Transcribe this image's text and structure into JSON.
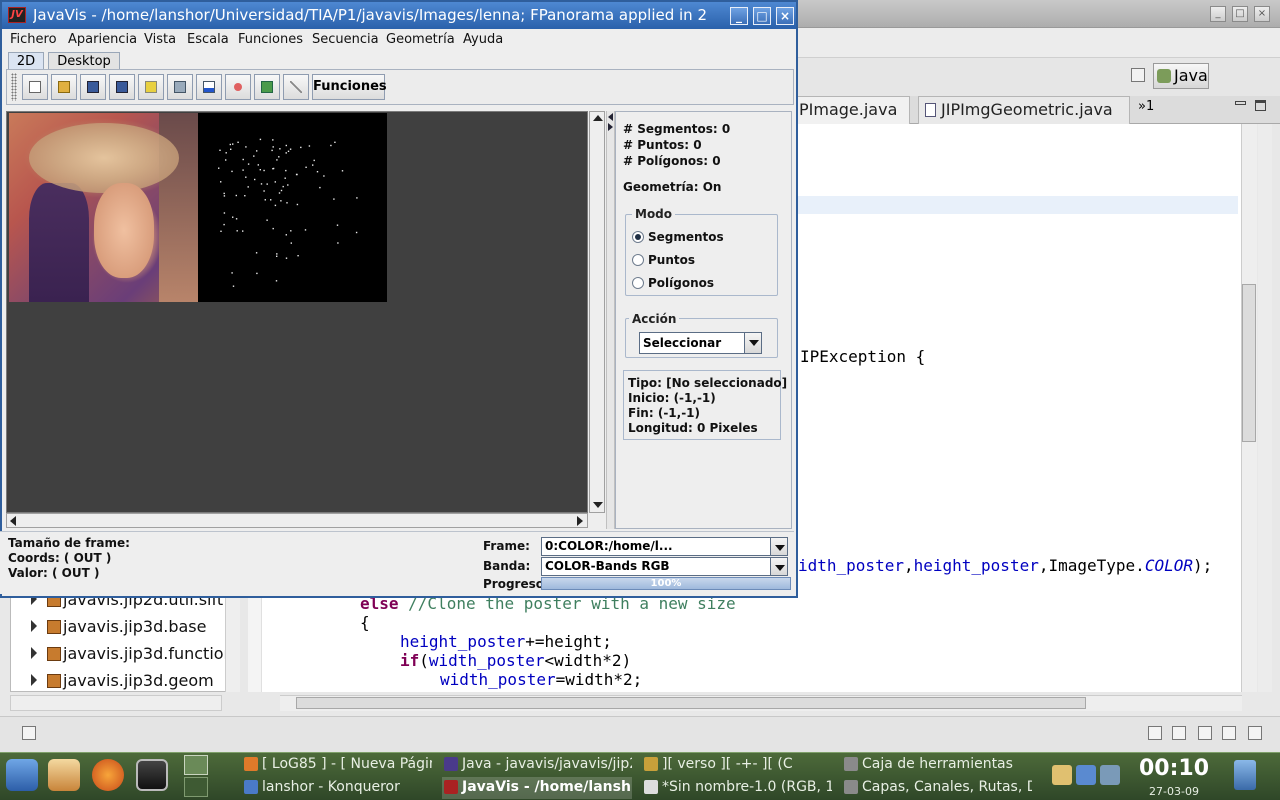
{
  "eclipse": {
    "perspective_label": "Java",
    "tabs": [
      {
        "label": "PImage.java"
      },
      {
        "label": "JIPImgGeometric.java"
      }
    ],
    "tab_overflow": "»1",
    "code_lines": {
      "l1": "IPException {",
      "l2a": "idth_poster",
      "l2b": ",",
      "l2c": "height_poster",
      "l2d": ",ImageType.",
      "l2e": "COLOR",
      "l2f": ");",
      "l3a": "else",
      "l3b": " //Clone the poster with a new size",
      "l4": "{",
      "l5a": "height_poster",
      "l5b": "+=height;",
      "l6a": "if",
      "l6b": "(",
      "l6c": "width_poster",
      "l6d": "<width*2)",
      "l7a": "width_poster",
      "l7b": "=width*2;"
    },
    "tree_items": [
      {
        "label": "javavis.jip2d.util.sift"
      },
      {
        "label": "javavis.jip3d.base"
      },
      {
        "label": "javavis.jip3d.functior"
      },
      {
        "label": "javavis.jip3d.geom"
      }
    ]
  },
  "javavis": {
    "title": "JavaVis - /home/lanshor/Universidad/TIA/P1/javavis/Images/lenna; FPanorama applied in 2",
    "menus": [
      "Fichero",
      "Apariencia",
      "Vista",
      "Escala",
      "Funciones",
      "Secuencia",
      "Geometría",
      "Ayuda"
    ],
    "tabs": [
      "2D",
      "Desktop"
    ],
    "toolbar": {
      "buttons": [
        "new-icon",
        "open-icon",
        "save-icon",
        "save-as-icon",
        "image-icon",
        "edit-image-icon",
        "histogram-icon",
        "record-icon",
        "cube-icon",
        "line-icon"
      ],
      "funciones_label": "Funciones"
    },
    "side": {
      "segmentos": "# Segmentos: 0",
      "puntos": "# Puntos: 0",
      "poligonos": "# Polígonos: 0",
      "geometria": "Geometría: On",
      "modo_title": "Modo",
      "modo_options": [
        "Segmentos",
        "Puntos",
        "Polígonos"
      ],
      "modo_selected": "Segmentos",
      "accion_title": "Acción",
      "accion_value": "Seleccionar",
      "tipo": "Tipo:  [No seleccionado]",
      "inicio": "Inicio:  (-1,-1)",
      "fin": "Fin:  (-1,-1)",
      "longitud": "Longitud:  0 Pixeles"
    },
    "bottom": {
      "frame_size": "Tamaño de frame:",
      "coords": "Coords: ( OUT )",
      "valor": "Valor: ( OUT )",
      "frame_label": "Frame:",
      "frame_value": "0:COLOR:/home/l...",
      "banda_label": "Banda:",
      "banda_value": "COLOR-Bands RGB",
      "progreso_label": "Progreso:",
      "progreso_value": "100%",
      "progress_fraction": 1.0
    }
  },
  "taskbar": {
    "tasks_top": [
      {
        "label": "[ LoG85 ] - [ Nueva Págin"
      },
      {
        "label": "Java - javavis/javavis/jip2d"
      },
      {
        "label": "][ verso ][ -+- ][ (C"
      },
      {
        "label": "Caja de herramientas"
      }
    ],
    "tasks_bottom": [
      {
        "label": "lanshor - Konqueror"
      },
      {
        "label": "JavaVis - /home/lansh"
      },
      {
        "label": "*Sin nombre-1.0 (RGB, 1"
      },
      {
        "label": "Capas, Canales, Rutas, D"
      }
    ],
    "clock": "00:10",
    "date": "27-03-09"
  }
}
